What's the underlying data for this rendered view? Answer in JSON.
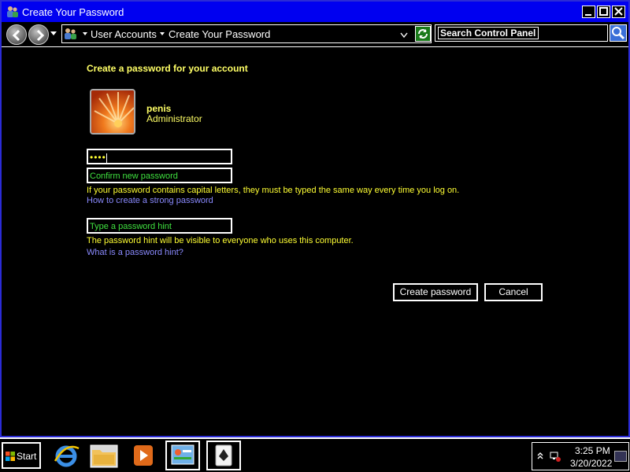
{
  "window": {
    "title": "Create Your Password",
    "controls": {
      "minimize": "_",
      "maximize": "□",
      "close": "✕"
    }
  },
  "navigation": {
    "breadcrumb": [
      "User Accounts",
      "Create Your Password"
    ],
    "search": {
      "value": "Search Control Panel"
    }
  },
  "content": {
    "heading": "Create a password for your account",
    "user": {
      "name": "penis",
      "role": "Administrator"
    },
    "new_password": {
      "value": "••••"
    },
    "confirm_password": {
      "placeholder": "Confirm new password"
    },
    "capital_note": "If your password contains capital letters, they must be typed the same way every time you log on.",
    "strong_password_link": "How to create a strong password",
    "hint": {
      "placeholder": "Type a password hint"
    },
    "hint_note": "The password hint will be visible to everyone who uses this computer.",
    "hint_link": "What is a password hint?",
    "buttons": {
      "create": "Create password",
      "cancel": "Cancel"
    }
  },
  "taskbar": {
    "start_label": "Start",
    "items": [
      "internet-explorer",
      "windows-explorer",
      "media-player",
      "control-panel",
      "solitaire"
    ],
    "clock": {
      "time": "3:25 PM",
      "date": "3/20/2022"
    }
  },
  "colors": {
    "title_bar": "#0000f0",
    "heading_text": "#ffff66",
    "field_text": "#3fe03f",
    "link_text": "#8a8aff",
    "background": "#000000"
  }
}
